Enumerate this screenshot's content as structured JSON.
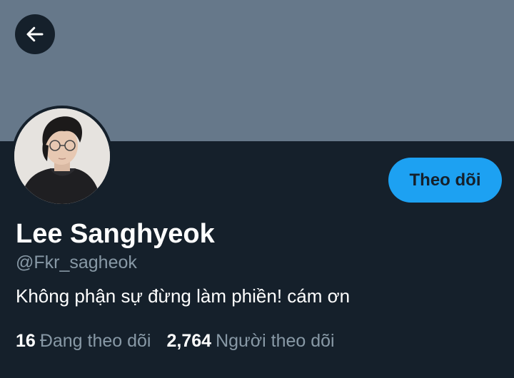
{
  "colors": {
    "background": "#15202b",
    "banner": "#66788a",
    "accent": "#1da1f2",
    "primary_text": "#ffffff",
    "secondary_text": "#8899a6"
  },
  "header": {
    "back_icon": "arrow-left-icon"
  },
  "profile": {
    "avatar_icon": "profile-photo",
    "display_name": "Lee Sanghyeok",
    "handle": "@Fkr_sagheok",
    "bio": "Không phận sự đừng làm phiền! cám ơn",
    "follow_label": "Theo dõi"
  },
  "stats": {
    "following_count": "16",
    "following_label": "Đang theo dõi",
    "followers_count": "2,764",
    "followers_label": "Người theo dõi"
  }
}
